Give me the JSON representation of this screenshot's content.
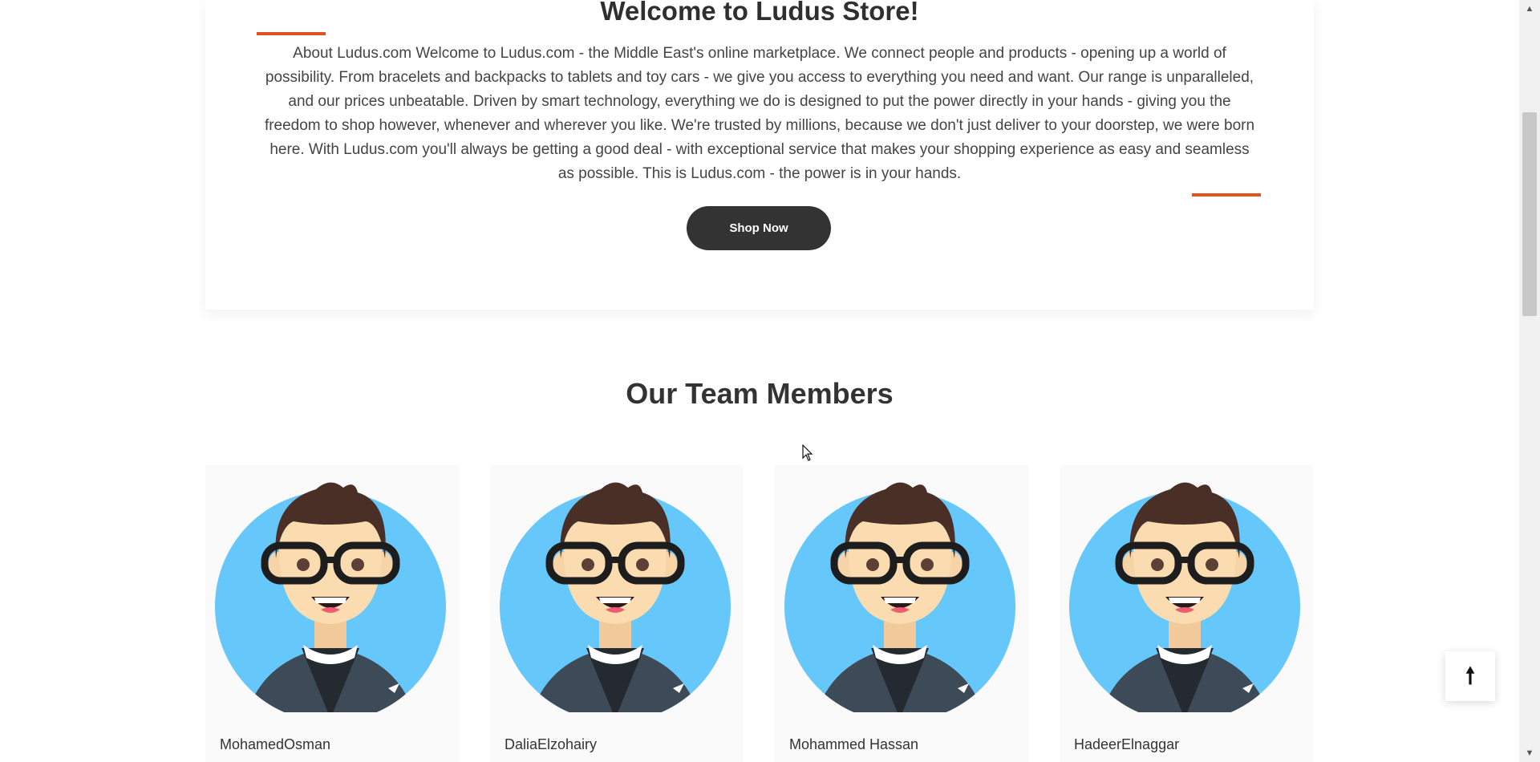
{
  "about": {
    "title": "Welcome to Ludus Store!",
    "text": "About Ludus.com Welcome to Ludus.com - the Middle East's online marketplace. We connect people and products - opening up a world of possibility. From bracelets and backpacks to tablets and toy cars - we give you access to everything you need and want. Our range is unparalleled, and our prices unbeatable. Driven by smart technology, everything we do is designed to put the power directly in your hands - giving you the freedom to shop however, whenever and wherever you like. We're trusted by millions, because we don't just deliver to your doorstep, we were born here. With Ludus.com you'll always be getting a good deal - with exceptional service that makes your shopping experience as easy and seamless as possible. This is Ludus.com - the power is in your hands.",
    "button_label": "Shop Now",
    "accent_color": "#e0531f"
  },
  "team": {
    "heading": "Our Team Members",
    "members": [
      {
        "name": "MohamedOsman"
      },
      {
        "name": "DaliaElzohairy"
      },
      {
        "name": "Mohammed Hassan"
      },
      {
        "name": "HadeerElnaggar"
      }
    ]
  },
  "back_to_top": {
    "icon": "arrow-up-icon",
    "glyph": "🠕"
  },
  "scrollbar": {
    "up_glyph": "▲",
    "down_glyph": "▼"
  }
}
